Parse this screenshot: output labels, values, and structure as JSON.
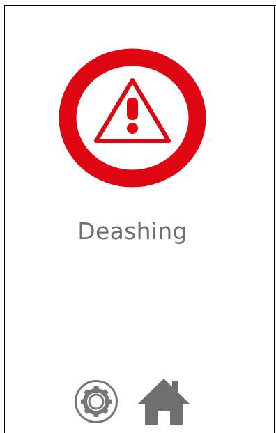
{
  "status": {
    "label": "Deashing",
    "icon": "warning-icon"
  },
  "toolbar": {
    "settings_icon": "gear-icon",
    "home_icon": "home-icon"
  },
  "colors": {
    "alert_red": "#dd0612",
    "label_gray": "#707070",
    "icon_gray": "#6f6f6f"
  }
}
